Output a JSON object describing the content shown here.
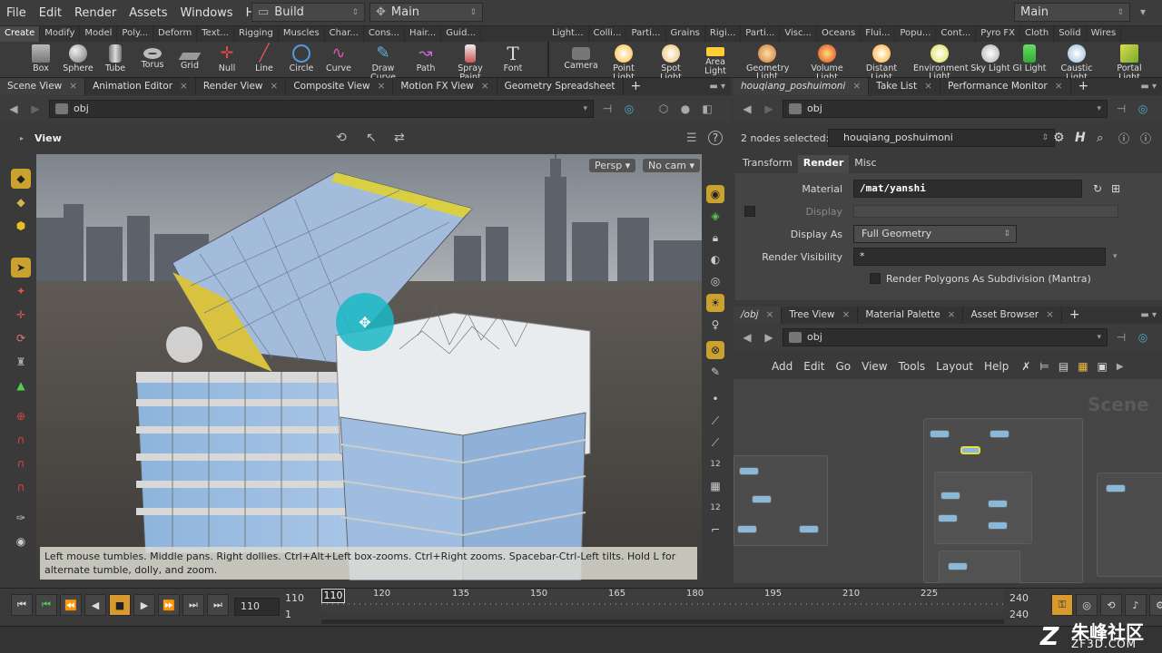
{
  "menu": [
    "File",
    "Edit",
    "Render",
    "Assets",
    "Windows",
    "Help"
  ],
  "desktop_left": "Build",
  "desktop_right_1": "Main",
  "desktop_right_2": "Main",
  "shelf_tabs_left": [
    "Create",
    "Modify",
    "Model",
    "Poly...",
    "Deform",
    "Text...",
    "Rigging",
    "Muscles",
    "Char...",
    "Cons...",
    "Hair...",
    "Guid..."
  ],
  "shelf_tabs_right": [
    "Light...",
    "Colli...",
    "Parti...",
    "Grains",
    "Rigi...",
    "Parti...",
    "Visc...",
    "Oceans",
    "Flui...",
    "Popu...",
    "Cont...",
    "Pyro FX",
    "Cloth",
    "Solid",
    "Wires"
  ],
  "tools_left": [
    "Box",
    "Sphere",
    "Tube",
    "Torus",
    "Grid",
    "Null",
    "Line",
    "Circle",
    "Curve",
    "Draw Curve",
    "Path",
    "Spray Paint",
    "Font"
  ],
  "tools_right": [
    "Camera",
    "Point Light",
    "Spot Light",
    "Area Light",
    "Geometry Light",
    "Volume Light",
    "Distant Light",
    "Environment Light",
    "Sky Light",
    "GI Light",
    "Caustic Light",
    "Portal Light"
  ],
  "left_tabs": [
    "Scene View",
    "Animation Editor",
    "Render View",
    "Composite View",
    "Motion FX View",
    "Geometry Spreadsheet"
  ],
  "left_path": "obj",
  "view_label": "View",
  "persp_label": "Persp",
  "cam_label": "No cam",
  "viewport_hint": "Left mouse tumbles. Middle pans. Right dollies. Ctrl+Alt+Left box-zooms. Ctrl+Right zooms. Spacebar-Ctrl-Left tilts. Hold L for alternate tumble, dolly, and zoom.",
  "right_tabs": [
    "houqiang_poshuimoni",
    "Take List",
    "Performance Monitor"
  ],
  "right_path": "obj",
  "nodes_selected_label": "2 nodes selected:",
  "nodes_selected_value": "houqiang_poshuimoni",
  "param_tabs": [
    "Transform",
    "Render",
    "Misc"
  ],
  "params": {
    "material_label": "Material",
    "material_value": "/mat/yanshi",
    "display_label": "Display",
    "display_as_label": "Display As",
    "display_as_value": "Full Geometry",
    "render_visibility_label": "Render Visibility",
    "render_visibility_value": "*",
    "render_polygons_label": "Render Polygons As Subdivision (Mantra)"
  },
  "net_tabs": [
    "/obj",
    "Tree View",
    "Material Palette",
    "Asset Browser"
  ],
  "net_path": "obj",
  "net_menu": [
    "Add",
    "Edit",
    "Go",
    "View",
    "Tools",
    "Layout",
    "Help"
  ],
  "net_watermark": "Scene",
  "timeline": {
    "current_frame": "110",
    "start_frame": "110",
    "start_frame_2": "1",
    "ticks": [
      "120",
      "135",
      "150",
      "165",
      "180",
      "195",
      "210",
      "225"
    ],
    "end_frame": "240",
    "end_frame_2": "240",
    "marker_frame": "110"
  },
  "watermark_text": "朱峰社区",
  "watermark_url": "ZF3D.COM"
}
